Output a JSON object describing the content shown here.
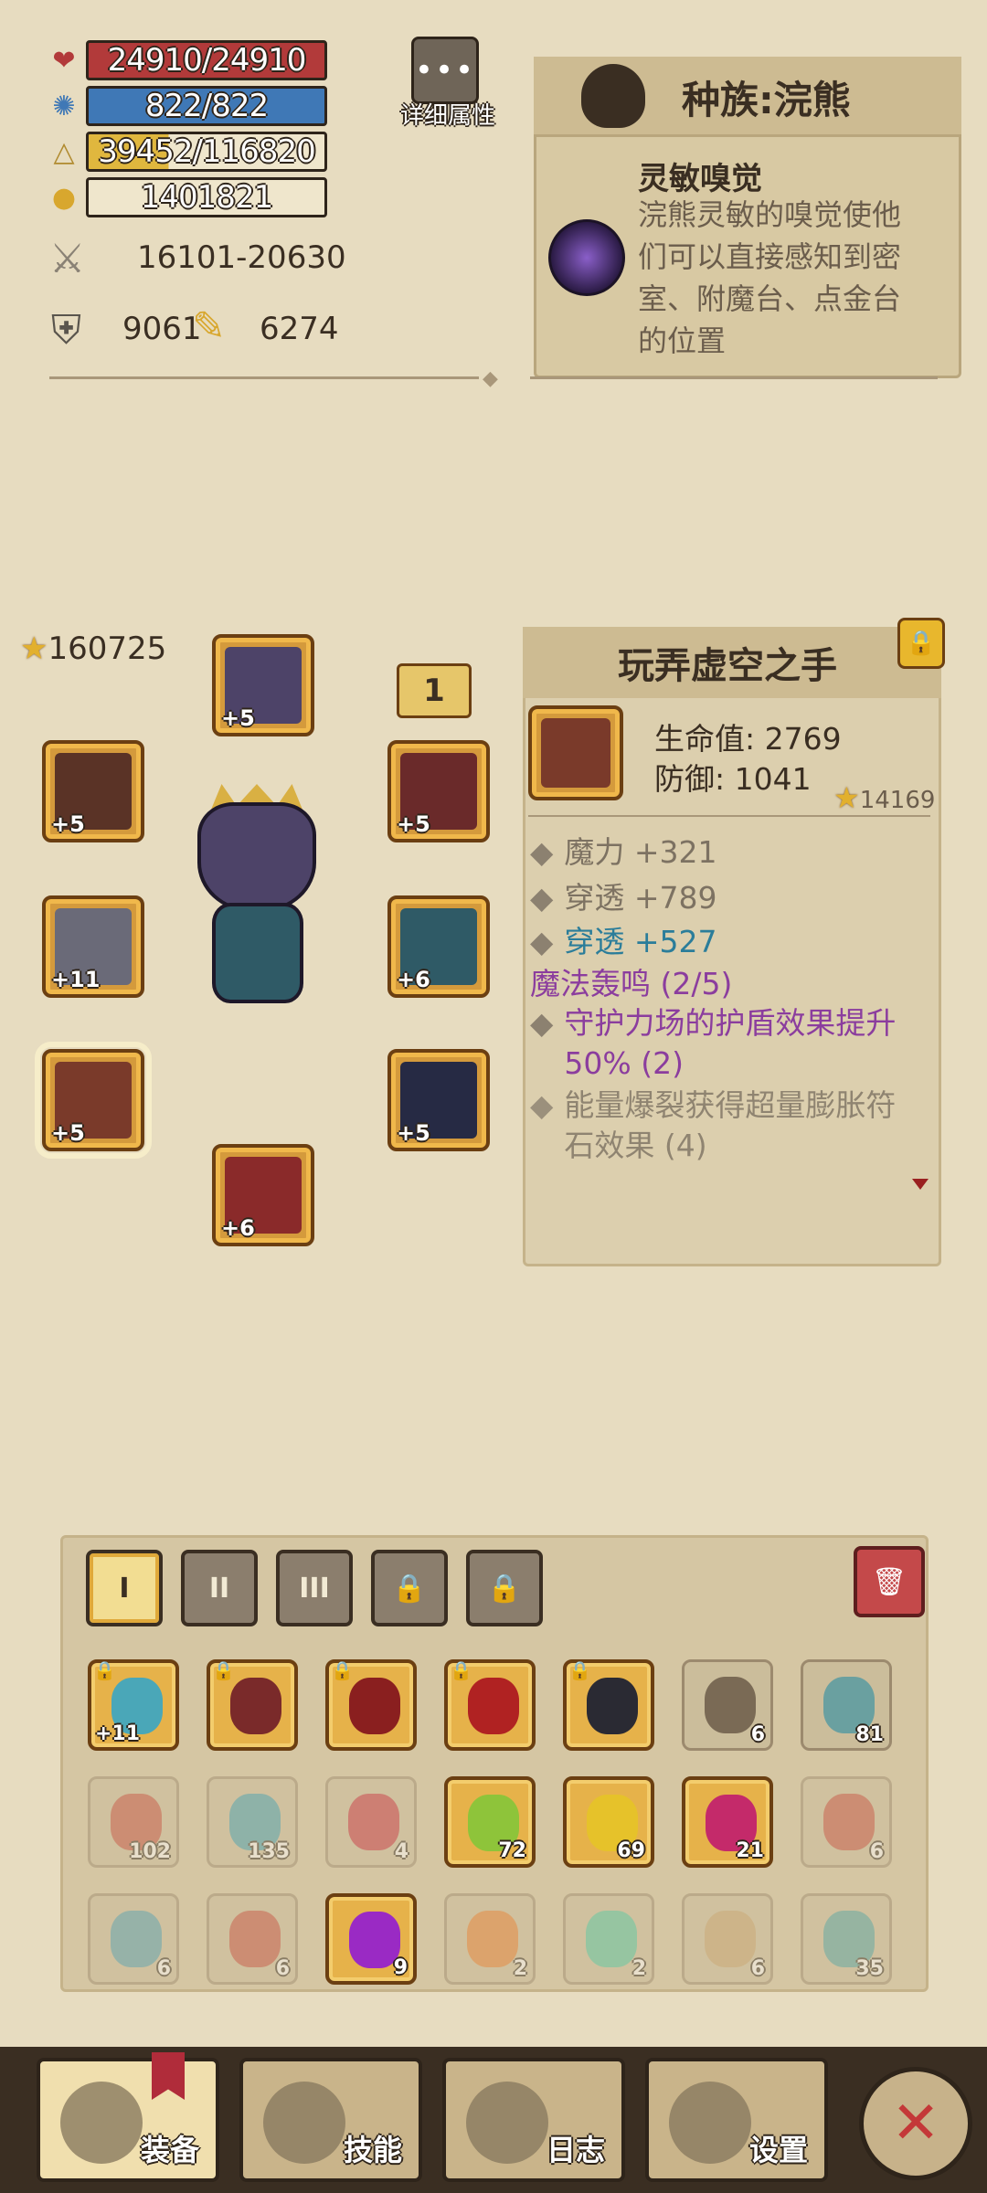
{
  "stats": {
    "hp": "24910/24910",
    "mp": "822/822",
    "xp": "39452/116820",
    "xp_fraction": 0.34,
    "gold": "1401821",
    "attack": "16101-20630",
    "defense": "9061",
    "magic": "6274"
  },
  "detail_button": {
    "dots": "•••",
    "label": "详细属性"
  },
  "race": {
    "title": "种族:浣熊",
    "trait_title": "灵敏嗅觉",
    "trait_desc": "浣熊灵敏的嗅觉使他们可以直接感知到密室、附魔台、点金台的位置"
  },
  "equipment": {
    "power": "160725",
    "tag": "1",
    "slots": [
      {
        "name": "helmet",
        "level": "+5"
      },
      {
        "name": "amulet",
        "level": "+5"
      },
      {
        "name": "cloak",
        "level": "+5"
      },
      {
        "name": "weapon",
        "level": "+11"
      },
      {
        "name": "shoulders",
        "level": "+6"
      },
      {
        "name": "gloves",
        "level": "+5"
      },
      {
        "name": "armor",
        "level": "+5"
      },
      {
        "name": "boots",
        "level": "+6"
      }
    ]
  },
  "item": {
    "name": "玩弄虚空之手",
    "lock_icon": "lock-icon",
    "hp_line": "生命值: 2769",
    "def_line": "防御: 1041",
    "score": "14169",
    "attrs": [
      {
        "text": "魔力 +321",
        "color": "gray"
      },
      {
        "text": "穿透 +789",
        "color": "gray"
      },
      {
        "text": "穿透 +527",
        "color": "blue"
      }
    ],
    "set_name": "魔法轰鸣 (2/5)",
    "set_bonus_1": "守护力场的护盾效果提升50% (2)",
    "set_bonus_2": "能量爆裂获得超量膨胀符石效果 (4)"
  },
  "inventory": {
    "tabs": [
      "I",
      "II",
      "III"
    ],
    "trash_icon": "trash-icon",
    "row1": [
      {
        "plus": "+11",
        "count": "",
        "locked": true,
        "color": "#4aa7b8"
      },
      {
        "plus": "",
        "count": "",
        "locked": true,
        "color": "#7a2a2a"
      },
      {
        "plus": "",
        "count": "",
        "locked": true,
        "color": "#8a1f1f"
      },
      {
        "plus": "",
        "count": "",
        "locked": true,
        "color": "#b02222"
      },
      {
        "plus": "",
        "count": "",
        "locked": true,
        "color": "#2a2a33"
      },
      {
        "plus": "",
        "count": "6",
        "locked": false,
        "color": "#7a6a55"
      },
      {
        "plus": "",
        "count": "81",
        "locked": false,
        "color": "#6aa0a0"
      }
    ],
    "row2": [
      {
        "count": "102",
        "dim": true,
        "color": "#c24a3a"
      },
      {
        "count": "135",
        "dim": true,
        "color": "#3a9ab0"
      },
      {
        "count": "4",
        "dim": true,
        "color": "#c42a3a"
      },
      {
        "count": "72",
        "dim": false,
        "color": "#8ec43a"
      },
      {
        "count": "69",
        "dim": false,
        "color": "#e6c22a"
      },
      {
        "count": "21",
        "dim": false,
        "color": "#c42a6a"
      },
      {
        "count": "6",
        "dim": true,
        "color": "#c24a3a"
      }
    ],
    "row3": [
      {
        "count": "6",
        "dim": true,
        "color": "#4a9ab0"
      },
      {
        "count": "6",
        "dim": true,
        "color": "#c24a3a"
      },
      {
        "count": "9",
        "dim": false,
        "color": "#9a2ac4"
      },
      {
        "count": "2",
        "dim": true,
        "color": "#e67a2a"
      },
      {
        "count": "2",
        "dim": true,
        "color": "#4ac4a0"
      },
      {
        "count": "6",
        "dim": true,
        "color": "#c4a06a"
      },
      {
        "count": "35",
        "dim": true,
        "color": "#4aa0a0"
      }
    ]
  },
  "nav": {
    "equip": "装备",
    "skills": "技能",
    "log": "日志",
    "settings": "设置",
    "close": "✕"
  }
}
